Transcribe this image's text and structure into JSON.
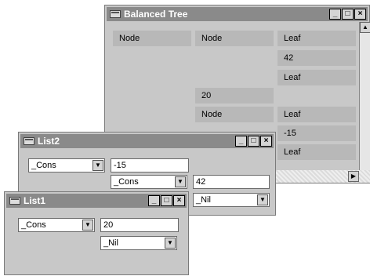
{
  "balanced_tree": {
    "title": "Balanced Tree",
    "cells": {
      "r1c1": "Node",
      "r1c2": "Node",
      "r1c3": "Leaf",
      "r2c3": "42",
      "r3c3": "Leaf",
      "r4c2": "20",
      "r5c2": "Node",
      "r5c3": "Leaf",
      "r6c3": "-15",
      "r7c3": "Leaf"
    }
  },
  "list2": {
    "title": "List2",
    "combo_outer": "_Cons",
    "field_value": "-15",
    "combo_inner": "_Cons",
    "field_inner": "42",
    "combo_nil": "_Nil"
  },
  "list1": {
    "title": "List1",
    "combo_outer": "_Cons",
    "field_value": "20",
    "combo_nil": "_Nil"
  },
  "window_buttons": {
    "minimize": "_",
    "maximize": "□",
    "close": "×"
  },
  "icons": {
    "combo_arrow": "▼",
    "scroll_up": "▲",
    "scroll_right": "▶"
  }
}
